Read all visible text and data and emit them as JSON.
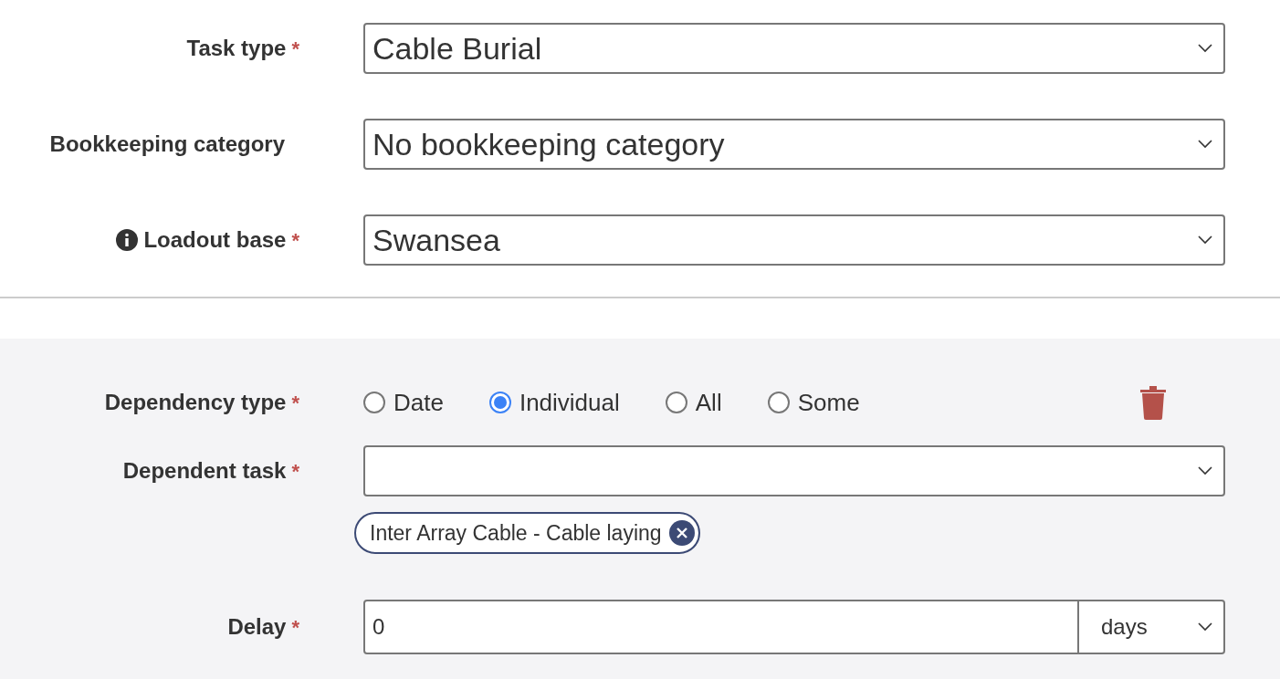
{
  "fields": [
    {
      "label": "Task type",
      "required_mark": "*",
      "info": false,
      "value": "Cable Burial"
    },
    {
      "label": "Bookkeeping category",
      "info": false,
      "value": "No bookkeeping category"
    },
    {
      "label": "Loadout base",
      "required_mark": "*",
      "info": true,
      "value": "Swansea"
    }
  ],
  "dependency": {
    "type_label": "Dependency type",
    "type_mark": "*",
    "options": [
      {
        "label": "Date",
        "selected": false
      },
      {
        "label": "Individual",
        "selected": true
      },
      {
        "label": "All",
        "selected": false
      },
      {
        "label": "Some",
        "selected": false
      }
    ],
    "task_label": "Dependent task",
    "task_mark": "*",
    "chips": [
      "Inter Array Cable - Cable laying"
    ],
    "delay_label": "Delay",
    "delay_mark": "*",
    "delay_value": "0",
    "delay_unit": "days"
  }
}
